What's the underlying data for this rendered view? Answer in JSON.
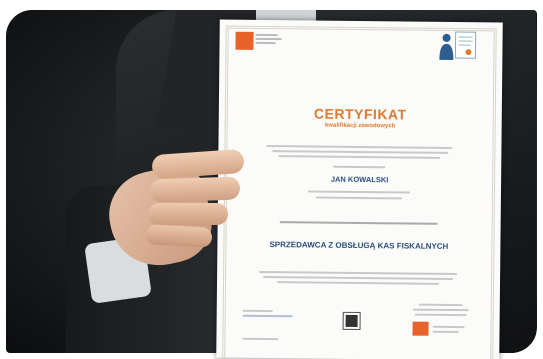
{
  "certificate": {
    "title": "CERTYFIKAT",
    "subtitle": "kwalifikacji zawodowych",
    "name": "JAN KOWALSKI",
    "occupation": "SPRZEDAWCA Z OBSŁUGĄ KAS FISKALNYCH"
  },
  "colors": {
    "accent": "#e07a2e",
    "name_blue": "#2a4f7e",
    "background": "#1d1f21"
  }
}
